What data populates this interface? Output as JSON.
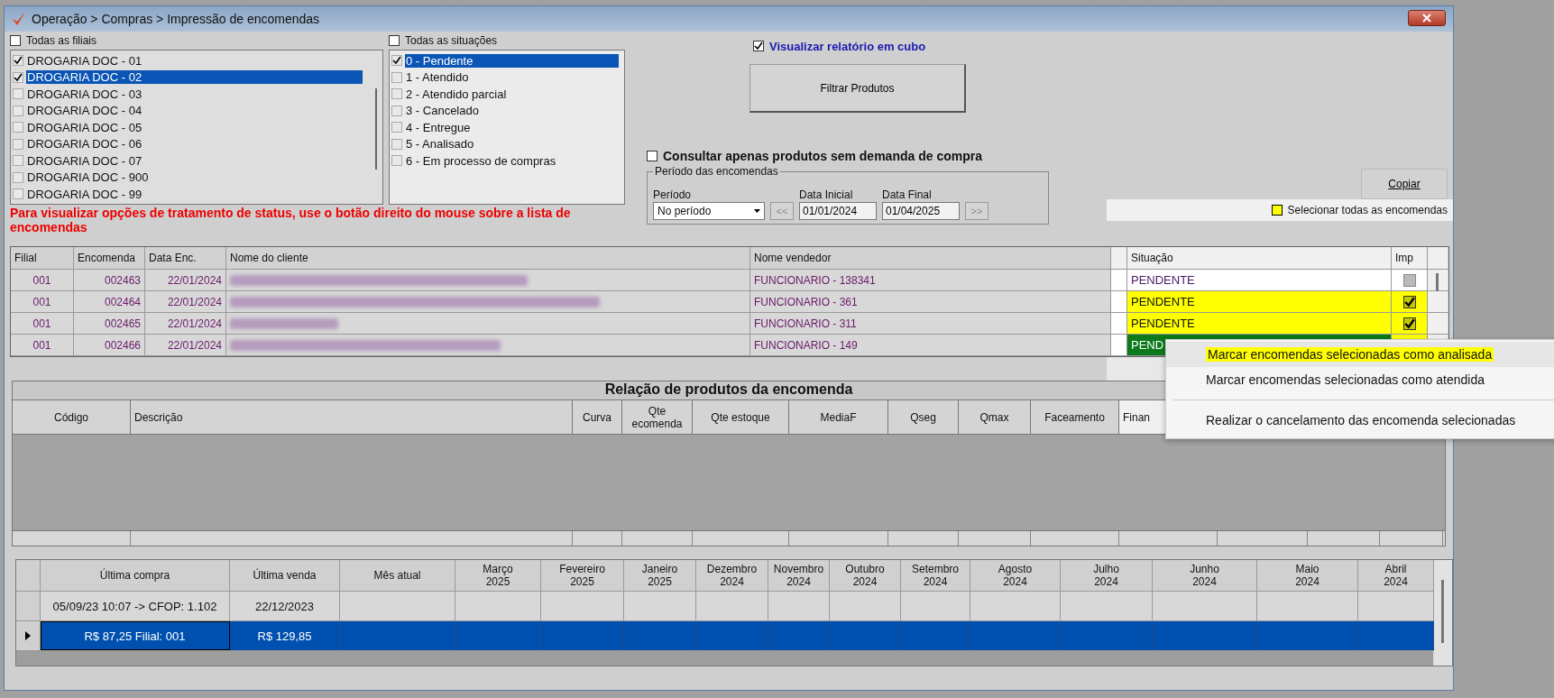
{
  "window": {
    "title": "Operação > Compras > Impressão de encomendas"
  },
  "branches": {
    "all_label": "Todas as filiais",
    "all_checked": false,
    "items": [
      {
        "label": "DROGARIA DOC - 01",
        "checked": true,
        "selected": false
      },
      {
        "label": "DROGARIA DOC - 02",
        "checked": true,
        "selected": true
      },
      {
        "label": "DROGARIA DOC - 03",
        "checked": false,
        "selected": false
      },
      {
        "label": "DROGARIA DOC - 04",
        "checked": false,
        "selected": false
      },
      {
        "label": "DROGARIA DOC - 05",
        "checked": false,
        "selected": false
      },
      {
        "label": "DROGARIA DOC - 06",
        "checked": false,
        "selected": false
      },
      {
        "label": "DROGARIA DOC - 07",
        "checked": false,
        "selected": false
      },
      {
        "label": "DROGARIA DOC - 900",
        "checked": false,
        "selected": false
      },
      {
        "label": "DROGARIA DOC - 99",
        "checked": false,
        "selected": false
      }
    ]
  },
  "statuses": {
    "all_label": "Todas as situações",
    "all_checked": false,
    "items": [
      {
        "label": "0 - Pendente",
        "checked": true,
        "selected": true
      },
      {
        "label": "1 - Atendido",
        "checked": false,
        "selected": false
      },
      {
        "label": "2 - Atendido parcial",
        "checked": false,
        "selected": false
      },
      {
        "label": "3 - Cancelado",
        "checked": false,
        "selected": false
      },
      {
        "label": "4 - Entregue",
        "checked": false,
        "selected": false
      },
      {
        "label": "5 - Analisado",
        "checked": false,
        "selected": false
      },
      {
        "label": "6 - Em processo de compras",
        "checked": false,
        "selected": false
      }
    ]
  },
  "cube_report": {
    "label": "Visualizar relatório em cubo",
    "checked": true
  },
  "filter_button": "Filtrar Produtos",
  "no_demand": {
    "label": "Consultar apenas produtos sem demanda de compra",
    "checked": false
  },
  "period": {
    "legend": "Período das encomendas",
    "type_label": "Período",
    "type_value": "No período",
    "prev": "<<",
    "start_label": "Data Inicial",
    "start": "01/01/2024",
    "end_label": "Data Final",
    "end": "01/04/2025",
    "next": ">>"
  },
  "copy_button": "Copiar",
  "select_all": {
    "label": "Selecionar todas as encomendas",
    "checked": false
  },
  "hint": "Para visualizar opções de tratamento de status, use o botão direito do mouse sobre a lista de encomendas",
  "orders": {
    "columns": [
      "Filial",
      "Encomenda",
      "Data Enc.",
      "Nome do cliente",
      "Nome vendedor",
      "Situação",
      "Imp"
    ],
    "rows": [
      {
        "branch": "001",
        "order": "002463",
        "date": "22/01/2024",
        "seller": "FUNCIONARIO - 138341",
        "status": "PENDENTE",
        "marked": false,
        "selected": false,
        "imp": false
      },
      {
        "branch": "001",
        "order": "002464",
        "date": "22/01/2024",
        "seller": "FUNCIONARIO - 361",
        "status": "PENDENTE",
        "marked": true,
        "selected": false,
        "imp": true
      },
      {
        "branch": "001",
        "order": "002465",
        "date": "22/01/2024",
        "seller": "FUNCIONARIO - 311",
        "status": "PENDENTE",
        "marked": true,
        "selected": false,
        "imp": true
      },
      {
        "branch": "001",
        "order": "002466",
        "date": "22/01/2024",
        "seller": "FUNCIONARIO - 149",
        "status": "PEND",
        "marked": false,
        "selected": true
      }
    ]
  },
  "products": {
    "title": "Relação de produtos da encomenda",
    "columns": [
      "Código",
      "Descrição",
      "Curva",
      "Qte ecomenda",
      "Qte estoque",
      "MediaF",
      "Qseg",
      "Qmax",
      "Faceamento",
      "Finan"
    ]
  },
  "history": {
    "columns": [
      {
        "month": "Última compra"
      },
      {
        "month": "Última venda"
      },
      {
        "month": "Mês atual"
      },
      {
        "month": "Março",
        "year": "2025"
      },
      {
        "month": "Fevereiro",
        "year": "2025"
      },
      {
        "month": "Janeiro",
        "year": "2025"
      },
      {
        "month": "Dezembro",
        "year": "2024"
      },
      {
        "month": "Novembro",
        "year": "2024"
      },
      {
        "month": "Outubro",
        "year": "2024"
      },
      {
        "month": "Setembro",
        "year": "2024"
      },
      {
        "month": "Agosto",
        "year": "2024"
      },
      {
        "month": "Julho",
        "year": "2024"
      },
      {
        "month": "Junho",
        "year": "2024"
      },
      {
        "month": "Maio",
        "year": "2024"
      },
      {
        "month": "Abril",
        "year": "2024"
      }
    ],
    "rows": [
      {
        "selected": false,
        "cells": [
          "05/09/23 10:07 -> CFOP: 1.102",
          "22/12/2023"
        ]
      },
      {
        "selected": true,
        "cells": [
          "R$ 87,25 Filial: 001",
          "R$ 129,85"
        ]
      }
    ]
  },
  "context_menu": [
    {
      "kind": "item",
      "label": "Marcar encomendas selecionadas como analisada",
      "highlighted": true
    },
    {
      "kind": "item",
      "label": "Marcar encomendas selecionadas como atendida",
      "highlighted": false
    },
    {
      "kind": "separator"
    },
    {
      "kind": "item",
      "label": "Realizar o cancelamento das encomenda selecionadas",
      "highlighted": false
    }
  ]
}
